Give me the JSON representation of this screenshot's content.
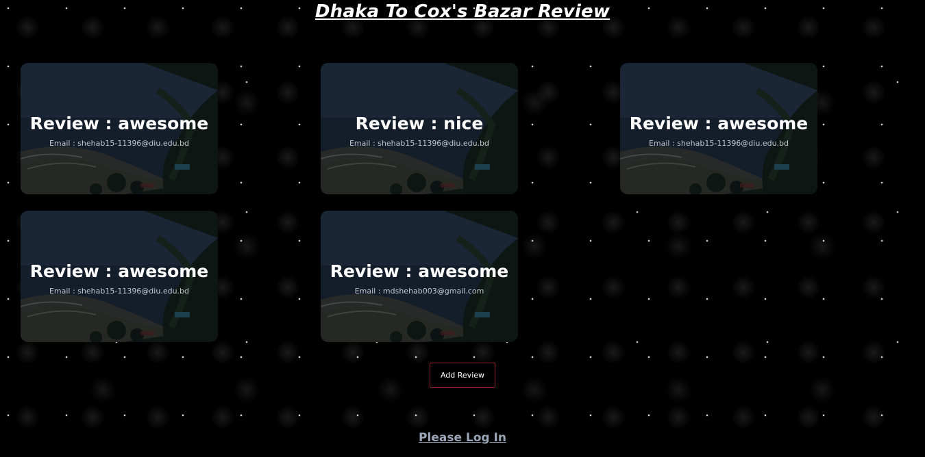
{
  "page": {
    "title": "Dhaka To Cox's Bazar Review"
  },
  "reviews": [
    {
      "title": "Review : awesome",
      "email": "Email : shehab15-11396@diu.edu.bd"
    },
    {
      "title": "Review : nice",
      "email": "Email : shehab15-11396@diu.edu.bd"
    },
    {
      "title": "Review : awesome",
      "email": "Email : shehab15-11396@diu.edu.bd"
    },
    {
      "title": "Review : awesome",
      "email": "Email : shehab15-11396@diu.edu.bd"
    },
    {
      "title": "Review : awesome",
      "email": "Email : mdshehab003@gmail.com"
    }
  ],
  "actions": {
    "add_review": "Add Review",
    "login": "Please Log In"
  },
  "colors": {
    "background": "#000000",
    "button_border": "#8b1e2b",
    "link": "#9aa6b8"
  }
}
